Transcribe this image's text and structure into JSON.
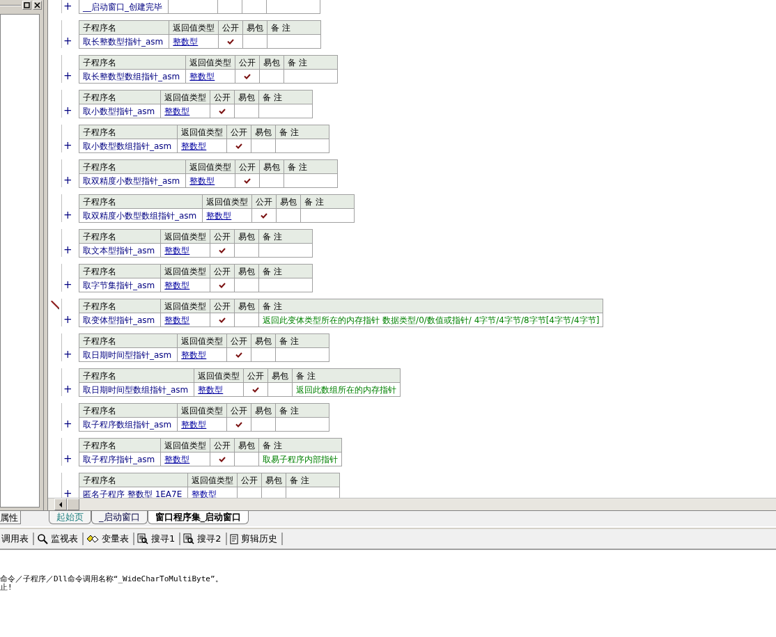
{
  "procedures": [
    {
      "name": "__启动窗口_创建完毕",
      "expander": "+",
      "current": false
    },
    {
      "columns": [
        "子程序名",
        "返回值类型",
        "公开",
        "易包",
        "备 注"
      ],
      "name": "取长整数型指针_asm",
      "return_type": "整数型",
      "public": true,
      "expander": "+",
      "current": false
    },
    {
      "columns": [
        "子程序名",
        "返回值类型",
        "公开",
        "易包",
        "备 注"
      ],
      "name": "取长整数型数组指针_asm",
      "return_type": "整数型",
      "public": true,
      "expander": "+",
      "current": false
    },
    {
      "columns": [
        "子程序名",
        "返回值类型",
        "公开",
        "易包",
        "备 注"
      ],
      "name": "取小数型指针_asm",
      "return_type": "整数型",
      "public": true,
      "expander": "+",
      "current": false
    },
    {
      "columns": [
        "子程序名",
        "返回值类型",
        "公开",
        "易包",
        "备 注"
      ],
      "name": "取小数型数组指针_asm",
      "return_type": "整数型",
      "public": true,
      "expander": "+",
      "current": false
    },
    {
      "columns": [
        "子程序名",
        "返回值类型",
        "公开",
        "易包",
        "备 注"
      ],
      "name": "取双精度小数型指针_asm",
      "return_type": "整数型",
      "public": true,
      "expander": "+",
      "current": false
    },
    {
      "columns": [
        "子程序名",
        "返回值类型",
        "公开",
        "易包",
        "备 注"
      ],
      "name": "取双精度小数型数组指针_asm",
      "return_type": "整数型",
      "public": true,
      "expander": "+",
      "current": false
    },
    {
      "columns": [
        "子程序名",
        "返回值类型",
        "公开",
        "易包",
        "备 注"
      ],
      "name": "取文本型指针_asm",
      "return_type": "整数型",
      "public": true,
      "expander": "+",
      "current": false
    },
    {
      "columns": [
        "子程序名",
        "返回值类型",
        "公开",
        "易包",
        "备 注"
      ],
      "name": "取字节集指针_asm",
      "return_type": "整数型",
      "public": true,
      "expander": "+",
      "current": false
    },
    {
      "columns": [
        "子程序名",
        "返回值类型",
        "公开",
        "易包",
        "备 注"
      ],
      "name": "取变体型指针_asm",
      "return_type": "整数型",
      "public": true,
      "remark": "返回此变体类型所在的内存指针   数据类型/0/数值或指针/    4字节/4字节/8字节[4字节/4字节]",
      "expander": "+",
      "current": true
    },
    {
      "columns": [
        "子程序名",
        "返回值类型",
        "公开",
        "易包",
        "备 注"
      ],
      "name": "取日期时间型指针_asm",
      "return_type": "整数型",
      "public": true,
      "expander": "+",
      "current": false
    },
    {
      "columns": [
        "子程序名",
        "返回值类型",
        "公开",
        "易包",
        "备 注"
      ],
      "name": "取日期时间型数组指针_asm",
      "return_type": "整数型",
      "public": true,
      "remark": "返回此数组所在的内存指针",
      "expander": "+",
      "current": false
    },
    {
      "columns": [
        "子程序名",
        "返回值类型",
        "公开",
        "易包",
        "备 注"
      ],
      "name": "取子程序数组指针_asm",
      "return_type": "整数型",
      "public": true,
      "expander": "+",
      "current": false
    },
    {
      "columns": [
        "子程序名",
        "返回值类型",
        "公开",
        "易包",
        "备 注"
      ],
      "name": "取子程序指针_asm",
      "return_type": "整数型",
      "public": true,
      "remark": "取易子程序内部指针",
      "expander": "+",
      "current": false
    },
    {
      "columns": [
        "子程序名",
        "返回值类型",
        "公开",
        "易包",
        "备 注"
      ],
      "name": "匿名子程序 整数型 1EA7E",
      "return_type": "整数型",
      "public": false,
      "expander": "+",
      "current": false
    }
  ],
  "left_panel": {
    "tab": "属性"
  },
  "editor_tabs": [
    {
      "label": "起始页",
      "selected": false
    },
    {
      "label": "_启动窗口",
      "selected": false
    },
    {
      "label": "窗口程序集_启动窗口",
      "selected": true
    }
  ],
  "tool_tabs": [
    {
      "label": "调用表"
    },
    {
      "label": "监视表"
    },
    {
      "label": "变量表"
    },
    {
      "label": "搜寻1"
    },
    {
      "label": "搜寻2"
    },
    {
      "label": "剪辑历史"
    }
  ],
  "output_lines": [
    "命令／子程序／Dll命令调用名称“_WideCharToMultiByte”。",
    "止!"
  ]
}
